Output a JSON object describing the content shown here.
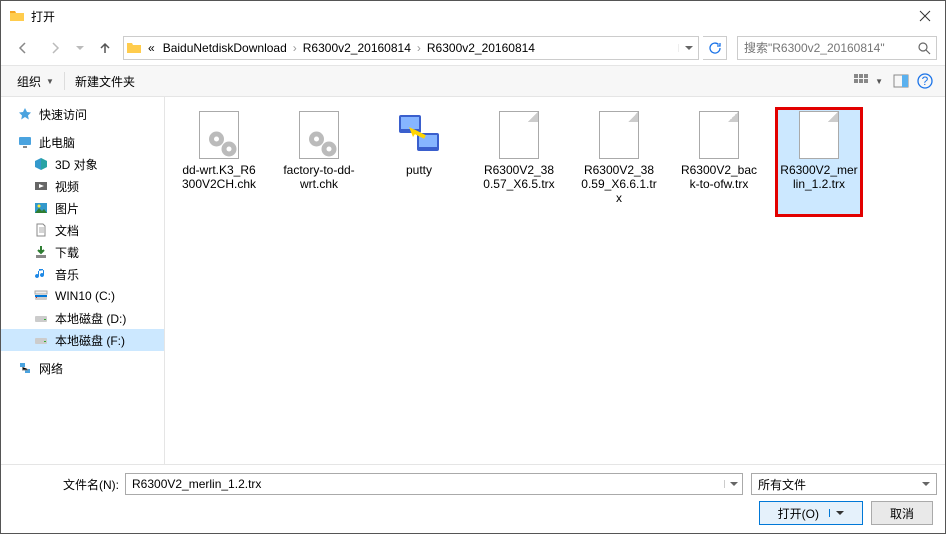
{
  "title": "打开",
  "breadcrumbs": [
    "BaiduNetdiskDownload",
    "R6300v2_20160814",
    "R6300v2_20160814"
  ],
  "breadcrumb_prefix": "«",
  "search_placeholder": "搜索\"R6300v2_20160814\"",
  "toolbar": {
    "organize": "组织",
    "new_folder": "新建文件夹"
  },
  "sidebar": {
    "quick_access": "快速访问",
    "this_pc": "此电脑",
    "children": [
      {
        "label": "3D 对象"
      },
      {
        "label": "视频"
      },
      {
        "label": "图片"
      },
      {
        "label": "文档"
      },
      {
        "label": "下载"
      },
      {
        "label": "音乐"
      },
      {
        "label": "WIN10 (C:)"
      },
      {
        "label": "本地磁盘 (D:)"
      },
      {
        "label": "本地磁盘 (F:)"
      }
    ],
    "network": "网络"
  },
  "files": [
    {
      "name": "dd-wrt.K3_R6300V2CH.chk",
      "type": "gear"
    },
    {
      "name": "factory-to-dd-wrt.chk",
      "type": "gear"
    },
    {
      "name": "putty",
      "type": "putty"
    },
    {
      "name": "R6300V2_380.57_X6.5.trx",
      "type": "blank"
    },
    {
      "name": "R6300V2_380.59_X6.6.1.trx",
      "type": "blank"
    },
    {
      "name": "R6300V2_back-to-ofw.trx",
      "type": "blank"
    },
    {
      "name": "R6300V2_merlin_1.2.trx",
      "type": "blank",
      "selected": true,
      "highlighted": true
    }
  ],
  "filename_label": "文件名(N):",
  "filename_value": "R6300V2_merlin_1.2.trx",
  "filter_label": "所有文件",
  "open_btn": "打开(O)",
  "cancel_btn": "取消"
}
